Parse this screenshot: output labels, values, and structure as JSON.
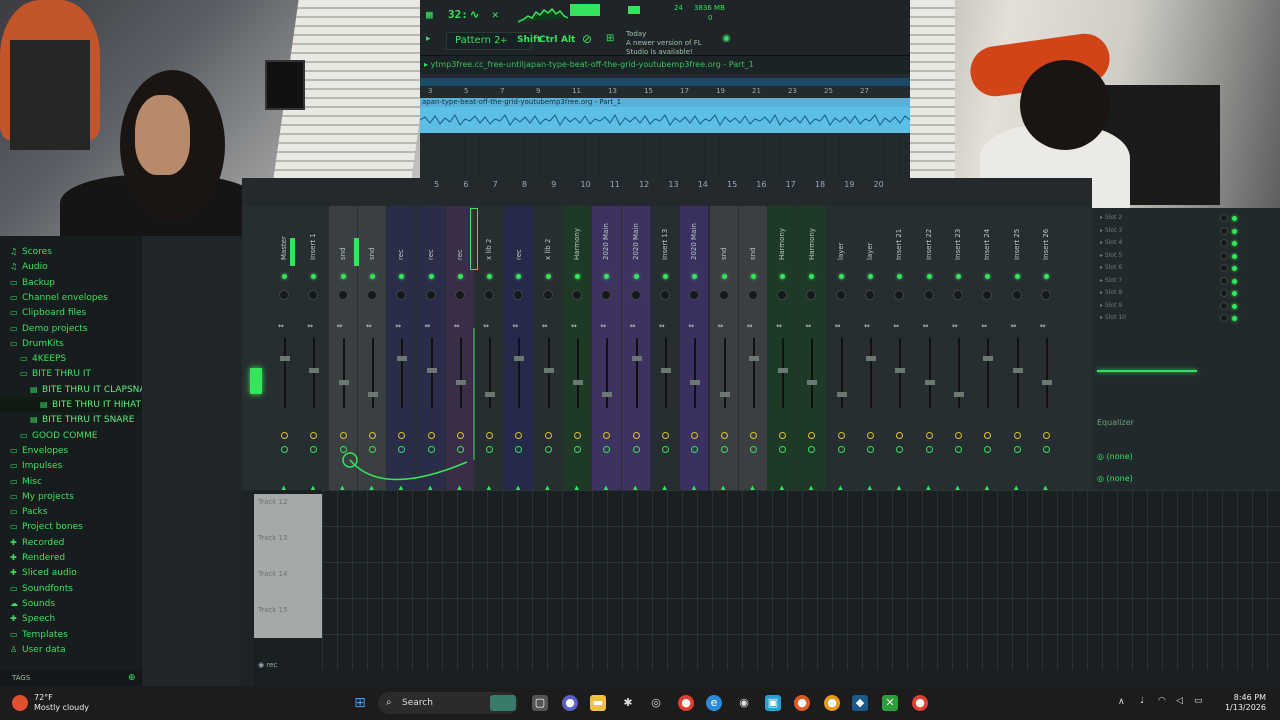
{
  "toolbar": {
    "pattern": "Pattern 2",
    "memory": "3836 MB",
    "cpu_voices": "24",
    "voices_zero": "0",
    "keys": [
      "Shift",
      "Ctrl",
      "Alt"
    ],
    "news_date": "Today",
    "news_text": "A newer version of FL Studio is available!",
    "time_small": "32:"
  },
  "playlist": {
    "title": "ytmp3free.cc_free-untiljapan-type-beat-off-the-grid-youtubemp3free.org - Part_1",
    "clip_label": "apan-type-beat-off-the-grid-youtubemp3free.org - Part_1",
    "timeline": [
      "3",
      "5",
      "7",
      "9",
      "11",
      "13",
      "15",
      "17",
      "19",
      "21",
      "23",
      "25",
      "27"
    ]
  },
  "browser": {
    "items": [
      {
        "label": "Scores",
        "icon": "note-icon",
        "indent": 0
      },
      {
        "label": "Audio",
        "icon": "note-icon",
        "indent": 0
      },
      {
        "label": "Backup",
        "icon": "folder-icon",
        "indent": 0
      },
      {
        "label": "Channel envelopes",
        "icon": "folder-icon",
        "indent": 0
      },
      {
        "label": "Clipboard files",
        "icon": "folder-icon",
        "indent": 0
      },
      {
        "label": "Demo projects",
        "icon": "folder-icon",
        "indent": 0
      },
      {
        "label": "DrumKits",
        "icon": "folder-icon",
        "indent": 0
      },
      {
        "label": "4KEEPS",
        "icon": "folder-icon",
        "indent": 1
      },
      {
        "label": "BITE THRU IT",
        "icon": "folder-icon",
        "indent": 1
      },
      {
        "label": "BITE THRU IT CLAPSNARE",
        "icon": "file-icon",
        "indent": 2
      },
      {
        "label": "BITE THRU IT HIHAT",
        "icon": "file-icon",
        "indent": 3
      },
      {
        "label": "BITE THRU IT SNARE",
        "icon": "file-icon",
        "indent": 2
      },
      {
        "label": "GOOD COMME",
        "icon": "folder-icon",
        "indent": 1
      },
      {
        "label": "Envelopes",
        "icon": "folder-icon",
        "indent": 0
      },
      {
        "label": "Impulses",
        "icon": "folder-icon",
        "indent": 0
      },
      {
        "label": "Misc",
        "icon": "folder-icon",
        "indent": 0
      },
      {
        "label": "My projects",
        "icon": "folder-icon",
        "indent": 0
      },
      {
        "label": "Packs",
        "icon": "folder-icon",
        "indent": 0
      },
      {
        "label": "Project bones",
        "icon": "folder-icon",
        "indent": 0
      },
      {
        "label": "Recorded",
        "icon": "plus-icon",
        "indent": 0
      },
      {
        "label": "Rendered",
        "icon": "plus-icon",
        "indent": 0
      },
      {
        "label": "Sliced audio",
        "icon": "plus-icon",
        "indent": 0
      },
      {
        "label": "Soundfonts",
        "icon": "folder-icon",
        "indent": 0
      },
      {
        "label": "Sounds",
        "icon": "cloud-icon",
        "indent": 0
      },
      {
        "label": "Speech",
        "icon": "plus-icon",
        "indent": 0
      },
      {
        "label": "Templates",
        "icon": "folder-icon",
        "indent": 0
      },
      {
        "label": "User data",
        "icon": "person-icon",
        "indent": 0
      }
    ],
    "footer": "TAGS"
  },
  "mixer": {
    "header_numbers": [
      "5",
      "6",
      "7",
      "8",
      "9",
      "10",
      "11",
      "12",
      "13",
      "14",
      "15",
      "16",
      "17",
      "18",
      "19",
      "20"
    ],
    "inserts": [
      {
        "name": "Master",
        "color": "#272e31"
      },
      {
        "name": "Insert 1",
        "color": "#272e31"
      },
      {
        "name": "snd",
        "color": "#3a3f42"
      },
      {
        "name": "snd",
        "color": "#3a3f42"
      },
      {
        "name": "rec",
        "color": "#2a2d47"
      },
      {
        "name": "rec",
        "color": "#2a2d47"
      },
      {
        "name": "rec",
        "color": "#3a2d47"
      },
      {
        "name": "x lib 2",
        "color": "#272e31"
      },
      {
        "name": "rec",
        "color": "#262a4a"
      },
      {
        "name": "x lib 2",
        "color": "#272e31"
      },
      {
        "name": "Harmony",
        "color": "#1e3a26"
      },
      {
        "name": "2020 Main",
        "color": "#3e3360"
      },
      {
        "name": "2020 Main",
        "color": "#3e3360"
      },
      {
        "name": "Insert 13",
        "color": "#272e31"
      },
      {
        "name": "2020 Main",
        "color": "#3a3160"
      },
      {
        "name": "snd",
        "color": "#3c3f41"
      },
      {
        "name": "snd",
        "color": "#3c3f41"
      },
      {
        "name": "Harmony",
        "color": "#1e3a26"
      },
      {
        "name": "Harmony",
        "color": "#1e3a26"
      },
      {
        "name": "layer",
        "color": "#272e31"
      },
      {
        "name": "layer",
        "color": "#272e31"
      },
      {
        "name": "Insert 21",
        "color": "#272e31"
      },
      {
        "name": "Insert 22",
        "color": "#272e31"
      },
      {
        "name": "Insert 23",
        "color": "#272e31"
      },
      {
        "name": "Insert 24",
        "color": "#272e31"
      },
      {
        "name": "Insert 25",
        "color": "#272e31"
      },
      {
        "name": "Insert 26",
        "color": "#272e31"
      }
    ],
    "fx_slots": [
      "Slot 2",
      "Slot 3",
      "Slot 4",
      "Slot 5",
      "Slot 6",
      "Slot 7",
      "Slot 8",
      "Slot 9",
      "Slot 10"
    ],
    "equalizer": "Equalizer",
    "fx_rows": [
      "(none)",
      "(none)"
    ]
  },
  "tracks": [
    "Track 12",
    "Track 13",
    "Track 14",
    "Track 15"
  ],
  "tracks_footer": "rec",
  "taskbar": {
    "temp": "72°F",
    "weather": "Mostly cloudy",
    "search": "Search",
    "time": "8:46 PM",
    "date": "1/13/2026"
  },
  "colors": {
    "accent": "#35e35c",
    "panel": "#272e31",
    "waveform": "#5cc0e6"
  }
}
